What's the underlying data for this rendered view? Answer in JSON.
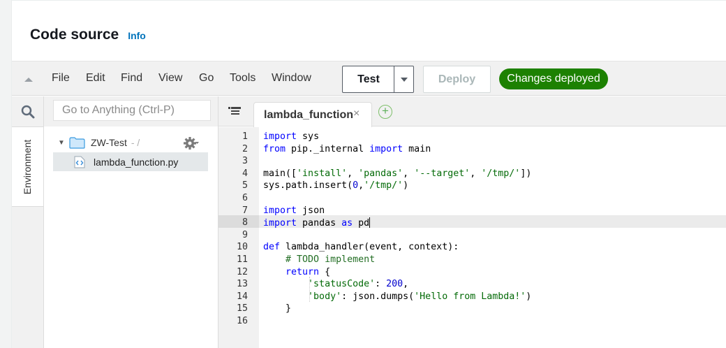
{
  "header": {
    "title": "Code source",
    "info_link": "Info"
  },
  "menu": {
    "items": [
      "File",
      "Edit",
      "Find",
      "View",
      "Go",
      "Tools",
      "Window"
    ]
  },
  "toolbar": {
    "test_label": "Test",
    "deploy_label": "Deploy",
    "status_badge": "Changes deployed",
    "status_color": "#1d8102"
  },
  "sidebar": {
    "search_placeholder": "Go to Anything (Ctrl-P)",
    "environment_tab": "Environment",
    "tree": {
      "root_name": "ZW-Test",
      "root_path": "- /",
      "files": [
        "lambda_function.py"
      ]
    }
  },
  "editor": {
    "tab_label": "lambda_function",
    "tab_close": "×",
    "tab_add": "+",
    "active_line": 8,
    "lines": [
      "import sys",
      "from pip._internal import main",
      "",
      "main(['install', 'pandas', '--target', '/tmp/'])",
      "sys.path.insert(0,'/tmp/')",
      "",
      "import json",
      "import pandas as pd",
      "",
      "def lambda_handler(event, context):",
      "    # TODO implement",
      "    return {",
      "        'statusCode': 200,",
      "        'body': json.dumps('Hello from Lambda!')",
      "    }",
      ""
    ]
  }
}
